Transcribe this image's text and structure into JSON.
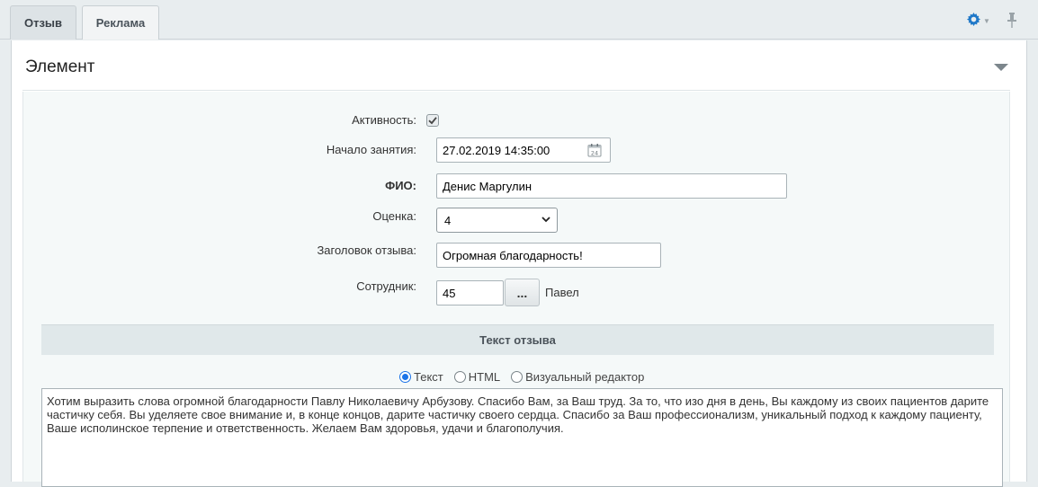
{
  "tabs": [
    {
      "label": "Отзыв",
      "active": true
    },
    {
      "label": "Реклама",
      "active": false
    }
  ],
  "toolbar": {
    "settings_icon": "gear-icon",
    "pin_icon": "pin-icon"
  },
  "panel": {
    "title": "Элемент"
  },
  "form": {
    "active": {
      "label": "Активность:",
      "checked": true
    },
    "start": {
      "label": "Начало занятия:",
      "value": "27.02.2019 14:35:00",
      "calendar_day": "24"
    },
    "fio": {
      "label": "ФИО:",
      "value": "Денис Маргулин"
    },
    "rating": {
      "label": "Оценка:",
      "value": "4"
    },
    "title": {
      "label": "Заголовок отзыва:",
      "value": "Огромная благодарность!"
    },
    "employee": {
      "label": "Сотрудник:",
      "value": "45",
      "button": "...",
      "name": "Павел"
    }
  },
  "review": {
    "section_title": "Текст отзыва",
    "modes": [
      "Текст",
      "HTML",
      "Визуальный редактор"
    ],
    "selected_mode": "Текст",
    "text": "Хотим выразить слова огромной благодарности Павлу Николаевичу Арбузову. Спасибо Вам, за Ваш труд. За то, что изо дня в день, Вы каждому из своих пациентов дарите частичку себя. Вы уделяете свое внимание и, в конце концов, дарите частичку своего сердца. Спасибо за Ваш профессионализм, уникальный подход к каждому пациенту, Ваше исполинское терпение и ответственность. Желаем Вам здоровья, удачи и благополучия."
  },
  "colors": {
    "accent": "#1a73e8",
    "gear": "#1f78c8"
  }
}
